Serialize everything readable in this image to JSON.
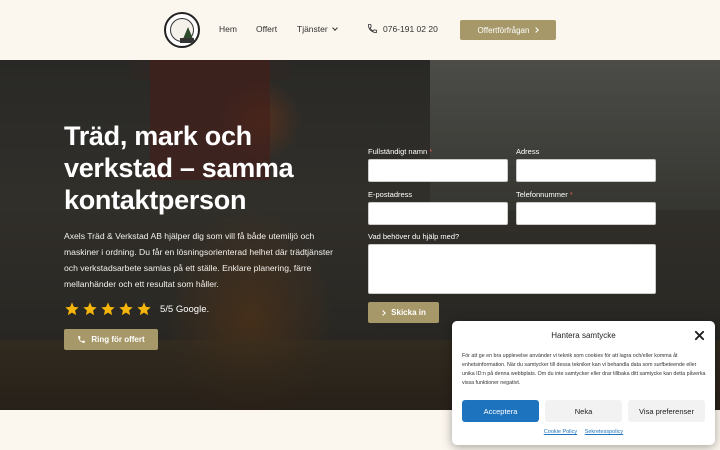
{
  "nav": {
    "items": [
      {
        "label": "Hem"
      },
      {
        "label": "Offert"
      },
      {
        "label": "Tjänster"
      }
    ],
    "phone": "076-191 02 20",
    "cta": "Offertförfrågan"
  },
  "hero": {
    "title": "Träd, mark och verkstad – samma kontaktperson",
    "description": "Axels Träd & Verkstad AB hjälper dig som vill få både utemiljö och maskiner i ordning. Du får en lösningsorienterad helhet där trädtjänster och verkstadsarbete samlas på ett ställe. Enklare planering, färre mellanhänder och ett resultat som håller.",
    "rating": {
      "stars": 5,
      "text": "5/5 Google."
    },
    "cta": "Ring för offert"
  },
  "form": {
    "name_label": "Fullständigt namn",
    "address_label": "Adress",
    "email_label": "E-postadress",
    "phone_label": "Telefonnummer",
    "message_label": "Vad behöver du hjälp med?",
    "required_marker": "*",
    "submit": "Skicka in"
  },
  "consent": {
    "title": "Hantera samtycke",
    "text": "För att ge en bra upplevelse använder vi teknik som cookies för att lagra och/eller komma åt enhetsinformation. När du samtycker till dessa tekniker kan vi behandla data som surfbeteende eller unika ID:n på denna webbplats. Om du inte samtycker eller drar tillbaka ditt samtycke kan detta påverka vissa funktioner negativt.",
    "accept": "Acceptera",
    "deny": "Neka",
    "preferences": "Visa preferenser",
    "links": [
      "Cookie Policy",
      "Sekretesspolicy"
    ]
  },
  "colors": {
    "accent": "#a69868",
    "background": "#fbf6ee",
    "consent_primary": "#1e73be",
    "star": "#f5b50a"
  }
}
